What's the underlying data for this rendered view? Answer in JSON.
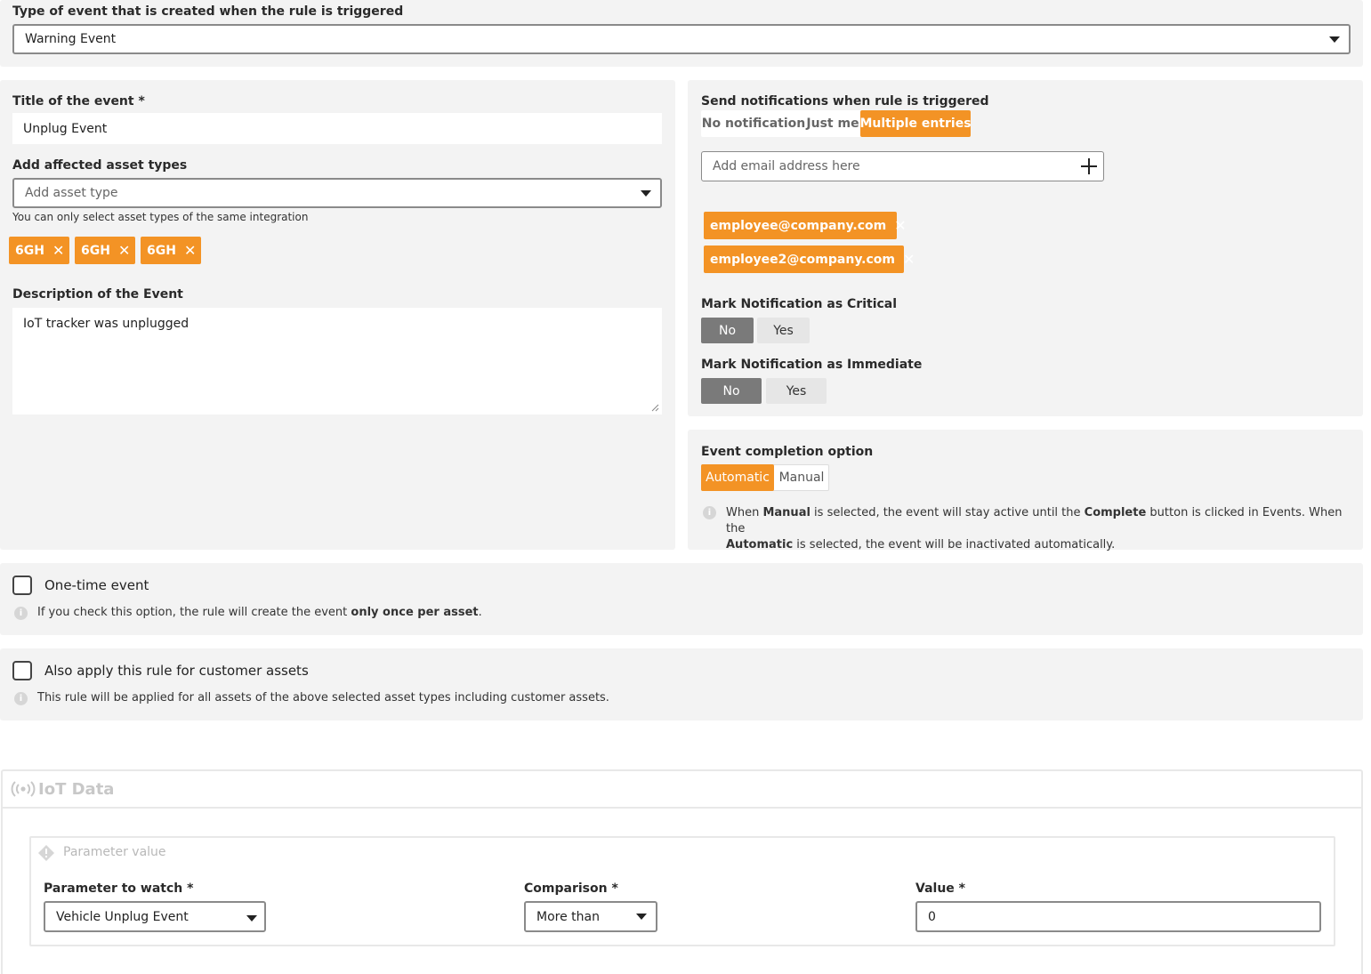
{
  "event_type": {
    "label": "Type of event that is created when the rule is triggered",
    "value": "Warning Event"
  },
  "event_details": {
    "title_label": "Title of the event *",
    "title_value": "Unplug Event",
    "asset_types_label": "Add affected asset types",
    "asset_types_placeholder": "Add asset type",
    "asset_types_hint": "You can only select asset types of the same integration",
    "asset_tags": [
      "6GH",
      "6GH",
      "6GH"
    ],
    "description_label": "Description of the Event",
    "description_value": "IoT tracker was unplugged"
  },
  "notifications": {
    "label": "Send notifications when rule is triggered",
    "options": [
      "No notification",
      "Just me",
      "Multiple entries"
    ],
    "selected": "Multiple entries",
    "email_placeholder": "Add email address here",
    "emails": [
      "employee@company.com",
      "employee2@company.com"
    ],
    "critical_label": "Mark Notification as Critical",
    "immediate_label": "Mark Notification as Immediate",
    "no_label": "No",
    "yes_label": "Yes"
  },
  "completion": {
    "label": "Event completion option",
    "options": [
      "Automatic",
      "Manual"
    ],
    "selected": "Automatic",
    "info": {
      "p1": "When ",
      "b1": "Manual",
      "p2": " is selected, the event will stay active until the ",
      "b2": "Complete",
      "p3": " button is clicked in Events. When the",
      "b3": "Automatic",
      "p4": " is selected, the event will be inactivated automatically."
    }
  },
  "one_time": {
    "label": "One-time event",
    "checked": false,
    "hint_prefix": "If you check this option, the rule will create the event ",
    "hint_bold": "only once per asset",
    "hint_suffix": "."
  },
  "customer_assets": {
    "label": "Also apply this rule for customer assets",
    "checked": false,
    "hint": "This rule will be applied for all assets of the above selected asset types including customer assets."
  },
  "iot": {
    "title": "IoT Data",
    "param_title": "Parameter value",
    "parameter_label": "Parameter to watch *",
    "parameter_value": "Vehicle Unplug Event",
    "comparison_label": "Comparison *",
    "comparison_value": "More than",
    "value_label": "Value *",
    "value_value": "0"
  },
  "colors": {
    "accent": "#f39325",
    "panel_bg": "#f3f3f3",
    "selected_dark": "#7a7a7a"
  }
}
